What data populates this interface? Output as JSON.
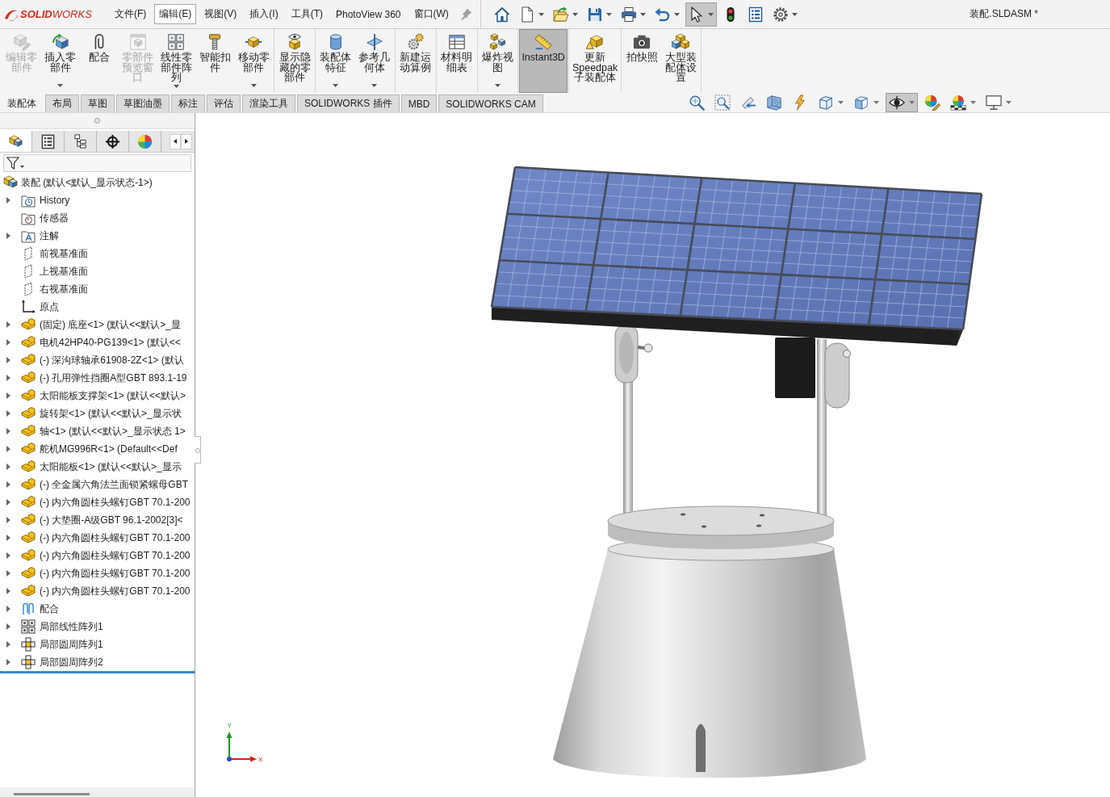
{
  "title_bar": {
    "logo": "**SOLID**WORKS",
    "menu": [
      {
        "label": "文件(F)",
        "selected": false
      },
      {
        "label": "编辑(E)",
        "selected": true
      },
      {
        "label": "视图(V)",
        "selected": false
      },
      {
        "label": "插入(I)",
        "selected": false
      },
      {
        "label": "工具(T)",
        "selected": false
      },
      {
        "label": "PhotoView 360",
        "selected": false
      },
      {
        "label": "窗口(W)",
        "selected": false
      }
    ],
    "quick_access": [
      {
        "dropdown": false,
        "selected": false
      },
      {
        "dropdown": true,
        "selected": false
      },
      {
        "dropdown": true,
        "selected": false
      },
      {
        "dropdown": true,
        "selected": false
      },
      {
        "dropdown": true,
        "selected": false
      },
      {
        "dropdown": true,
        "selected": false
      },
      {
        "dropdown": true,
        "selected": true
      },
      {
        "dropdown": false,
        "selected": false
      },
      {
        "dropdown": false,
        "selected": false
      },
      {
        "dropdown": true,
        "selected": false
      }
    ],
    "document_title": "装配.SLDASM *"
  },
  "ribbon": {
    "groups": [
      {
        "buttons": [
          {
            "label": "编辑零部件",
            "disabled": true,
            "dropdown": false,
            "selected": false
          },
          {
            "label": "插入零部件",
            "disabled": false,
            "dropdown": true,
            "selected": false
          },
          {
            "label": "配合",
            "disabled": false,
            "dropdown": false,
            "selected": false
          },
          {
            "label": "零部件预览窗口",
            "disabled": true,
            "dropdown": false,
            "selected": false
          },
          {
            "label": "线性零部件阵列",
            "disabled": false,
            "dropdown": true,
            "selected": false
          },
          {
            "label": "智能扣件",
            "disabled": false,
            "dropdown": false,
            "selected": false
          },
          {
            "label": "移动零部件",
            "disabled": false,
            "dropdown": true,
            "selected": false
          }
        ]
      },
      {
        "buttons": [
          {
            "label": "显示隐藏的零部件",
            "disabled": false,
            "dropdown": false,
            "selected": false
          }
        ]
      },
      {
        "buttons": [
          {
            "label": "装配体特征",
            "disabled": false,
            "dropdown": true,
            "selected": false
          },
          {
            "label": "参考几何体",
            "disabled": false,
            "dropdown": true,
            "selected": false
          }
        ]
      },
      {
        "buttons": [
          {
            "label": "新建运动算例",
            "disabled": false,
            "dropdown": false,
            "selected": false
          }
        ]
      },
      {
        "buttons": [
          {
            "label": "材料明细表",
            "disabled": false,
            "dropdown": false,
            "selected": false
          }
        ]
      },
      {
        "buttons": [
          {
            "label": "爆炸视图",
            "disabled": false,
            "dropdown": true,
            "selected": false
          }
        ]
      },
      {
        "buttons": [
          {
            "label": "Instant3D",
            "disabled": false,
            "dropdown": false,
            "selected": true
          }
        ]
      },
      {
        "buttons": [
          {
            "label": "更新Speedpak子装配体",
            "disabled": false,
            "dropdown": false,
            "selected": false
          }
        ]
      },
      {
        "buttons": [
          {
            "label": "拍快照",
            "disabled": false,
            "dropdown": false,
            "selected": false
          },
          {
            "label": "大型装配体设置",
            "disabled": false,
            "dropdown": false,
            "selected": false
          }
        ]
      }
    ]
  },
  "command_tabs": [
    {
      "label": "装配体",
      "selected": true
    },
    {
      "label": "布局",
      "selected": false
    },
    {
      "label": "草图",
      "selected": false
    },
    {
      "label": "草图油墨",
      "selected": false
    },
    {
      "label": "标注",
      "selected": false
    },
    {
      "label": "评估",
      "selected": false
    },
    {
      "label": "渲染工具",
      "selected": false
    },
    {
      "label": "SOLIDWORKS 插件",
      "selected": false
    },
    {
      "label": "MBD",
      "selected": false
    },
    {
      "label": "SOLIDWORKS CAM",
      "selected": false
    }
  ],
  "view_toolbar": [
    {
      "dropdown": false,
      "selected": false
    },
    {
      "dropdown": false,
      "selected": false
    },
    {
      "dropdown": false,
      "selected": false
    },
    {
      "dropdown": false,
      "selected": false
    },
    {
      "dropdown": false,
      "selected": false
    },
    {
      "dropdown": true,
      "selected": false
    },
    {
      "dropdown": true,
      "selected": false
    },
    {
      "dropdown": true,
      "selected": true
    },
    {
      "dropdown": false,
      "selected": false
    },
    {
      "dropdown": true,
      "selected": false
    },
    {
      "dropdown": true,
      "selected": false
    }
  ],
  "feature_manager": {
    "tabs": [
      {
        "selected": true
      },
      {
        "selected": false
      },
      {
        "selected": false
      },
      {
        "selected": false
      },
      {
        "selected": false
      }
    ],
    "tree": {
      "kind": "assembly",
      "label": "装配 (默认<默认_显示状态-1>)",
      "children": [
        {
          "kind": "history",
          "label": "History",
          "expandable": true
        },
        {
          "kind": "sensors",
          "label": "传感器",
          "expandable": false
        },
        {
          "kind": "annotations",
          "label": "注解",
          "expandable": true
        },
        {
          "kind": "plane",
          "label": "前视基准面",
          "expandable": false
        },
        {
          "kind": "plane",
          "label": "上视基准面",
          "expandable": false
        },
        {
          "kind": "plane",
          "label": "右视基准面",
          "expandable": false
        },
        {
          "kind": "origin",
          "label": "原点",
          "expandable": false
        },
        {
          "kind": "component",
          "label": "(固定) 底座<1> (默认<<默认>_显",
          "expandable": true
        },
        {
          "kind": "component",
          "label": "电机42HP40-PG139<1> (默认<<",
          "expandable": true
        },
        {
          "kind": "component",
          "label": "(-) 深沟球轴承61908-2Z<1> (默认",
          "expandable": true
        },
        {
          "kind": "component",
          "label": "(-) 孔用弹性挡圈A型GBT 893.1-19",
          "expandable": true
        },
        {
          "kind": "component",
          "label": "太阳能板支撑架<1> (默认<<默认>",
          "expandable": true
        },
        {
          "kind": "component",
          "label": "旋转架<1> (默认<<默认>_显示状",
          "expandable": true
        },
        {
          "kind": "component",
          "label": "轴<1> (默认<<默认>_显示状态 1>",
          "expandable": true
        },
        {
          "kind": "component",
          "label": "舵机MG996R<1> (Default<<Def",
          "expandable": true
        },
        {
          "kind": "component",
          "label": "太阳能板<1> (默认<<默认>_显示",
          "expandable": true
        },
        {
          "kind": "component",
          "label": "(-) 全金属六角法兰面锁紧螺母GBT",
          "expandable": true
        },
        {
          "kind": "component",
          "label": "(-) 内六角圆柱头螺钉GBT 70.1-200",
          "expandable": true
        },
        {
          "kind": "component",
          "label": "(-) 大垫圈-A级GBT 96.1-2002[3]<",
          "expandable": true
        },
        {
          "kind": "component",
          "label": "(-) 内六角圆柱头螺钉GBT 70.1-200",
          "expandable": true
        },
        {
          "kind": "component",
          "label": "(-) 内六角圆柱头螺钉GBT 70.1-200",
          "expandable": true
        },
        {
          "kind": "component",
          "label": "(-) 内六角圆柱头螺钉GBT 70.1-200",
          "expandable": true
        },
        {
          "kind": "component",
          "label": "(-) 内六角圆柱头螺钉GBT 70.1-200",
          "expandable": true
        },
        {
          "kind": "mates",
          "label": "配合",
          "expandable": true
        },
        {
          "kind": "linear-pattern",
          "label": "局部线性阵列1",
          "expandable": true
        },
        {
          "kind": "circular-pattern",
          "label": "局部圆周阵列1",
          "expandable": true
        },
        {
          "kind": "circular-pattern",
          "label": "局部圆周阵列2",
          "expandable": true
        }
      ]
    }
  },
  "viewport": {
    "triad": {
      "y_label": "Y",
      "x_label": "X"
    }
  }
}
